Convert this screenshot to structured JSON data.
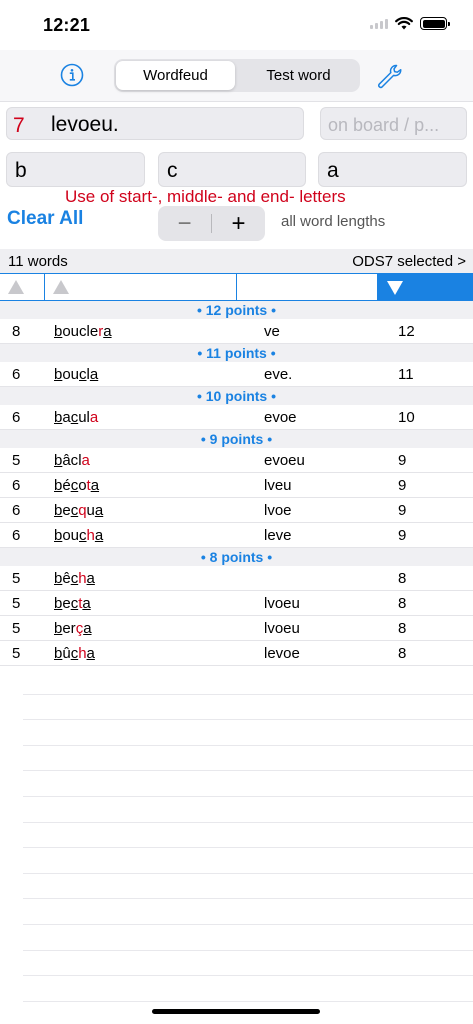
{
  "status": {
    "time": "12:21"
  },
  "toolbar": {
    "tabs": [
      {
        "label": "Wordfeud",
        "active": true
      },
      {
        "label": "Test word",
        "active": false
      }
    ],
    "info_icon": "info-icon",
    "settings_icon": "wrench-icon"
  },
  "inputs": {
    "length": "7",
    "letters": "levoeu.",
    "board_placeholder": "on board / p...",
    "start_letter": "b",
    "middle_letter": "c",
    "end_letter": "a"
  },
  "hint": "Use of start-, middle- and end- letters",
  "controls": {
    "clear_all": "Clear All",
    "minus": "−",
    "plus": "+",
    "lengths_label": "all word lengths"
  },
  "results": {
    "count": "11 words",
    "dictionary": "ODS7 selected >",
    "sections": [
      {
        "title": "• 12 points •",
        "rows": [
          {
            "len": "8",
            "parts": [
              [
                "b",
                "u"
              ],
              [
                "ouc",
                ""
              ],
              [
                "l",
                ""
              ],
              [
                "e",
                ""
              ],
              [
                "r",
                "r"
              ],
              [
                "a",
                "u"
              ]
            ],
            "rem": "ve",
            "pts": "12"
          }
        ]
      },
      {
        "title": "• 11 points •",
        "rows": [
          {
            "len": "6",
            "parts": [
              [
                "b",
                "u"
              ],
              [
                "ou",
                ""
              ],
              [
                "c",
                "u"
              ],
              [
                "l",
                ""
              ],
              [
                "a",
                "u"
              ]
            ],
            "rem": "eve.",
            "pts": "11"
          }
        ]
      },
      {
        "title": "• 10 points •",
        "rows": [
          {
            "len": "6",
            "parts": [
              [
                "b",
                "u"
              ],
              [
                "a",
                ""
              ],
              [
                "c",
                "u"
              ],
              [
                "u",
                ""
              ],
              [
                "l",
                ""
              ],
              [
                "a",
                "r"
              ]
            ],
            "rem": "evoe",
            "pts": "10"
          }
        ]
      },
      {
        "title": "• 9 points •",
        "rows": [
          {
            "len": "5",
            "parts": [
              [
                "b",
                "u"
              ],
              [
                "âc",
                ""
              ],
              [
                "l",
                ""
              ],
              [
                "a",
                "r"
              ]
            ],
            "rem": "evoeu",
            "pts": "9"
          },
          {
            "len": "6",
            "parts": [
              [
                "b",
                "u"
              ],
              [
                "é",
                ""
              ],
              [
                "c",
                "u"
              ],
              [
                "o",
                ""
              ],
              [
                "t",
                "r"
              ],
              [
                "a",
                "u"
              ]
            ],
            "rem": "lveu",
            "pts": "9"
          },
          {
            "len": "6",
            "parts": [
              [
                "b",
                "u"
              ],
              [
                "e",
                ""
              ],
              [
                "c",
                "u"
              ],
              [
                "q",
                "r"
              ],
              [
                "u",
                ""
              ],
              [
                "a",
                "u"
              ]
            ],
            "rem": "lvoe",
            "pts": "9"
          },
          {
            "len": "6",
            "parts": [
              [
                "b",
                "u"
              ],
              [
                "ou",
                ""
              ],
              [
                "c",
                "u"
              ],
              [
                "h",
                "r"
              ],
              [
                "a",
                "u"
              ]
            ],
            "rem": "leve",
            "pts": "9"
          }
        ]
      },
      {
        "title": "• 8 points •",
        "rows": [
          {
            "len": "5",
            "parts": [
              [
                "b",
                "u"
              ],
              [
                "ê",
                ""
              ],
              [
                "c",
                "u"
              ],
              [
                "h",
                "r"
              ],
              [
                "a",
                "u"
              ]
            ],
            "rem": "",
            "pts": "8"
          },
          {
            "len": "5",
            "parts": [
              [
                "b",
                "u"
              ],
              [
                "e",
                ""
              ],
              [
                "c",
                "u"
              ],
              [
                "t",
                "r"
              ],
              [
                "a",
                "u"
              ]
            ],
            "rem": "lvoeu",
            "pts": "8"
          },
          {
            "len": "5",
            "parts": [
              [
                "b",
                "u"
              ],
              [
                "er",
                ""
              ],
              [
                "ç",
                "r"
              ],
              [
                "a",
                "u"
              ]
            ],
            "rem": "lvoeu",
            "pts": "8"
          },
          {
            "len": "5",
            "parts": [
              [
                "b",
                "u"
              ],
              [
                "û",
                ""
              ],
              [
                "c",
                "u"
              ],
              [
                "h",
                "r"
              ],
              [
                "a",
                "u"
              ]
            ],
            "rem": "levoe",
            "pts": "8"
          }
        ]
      }
    ]
  },
  "colors": {
    "accent": "#1a82e2",
    "highlight": "#d0021b"
  }
}
